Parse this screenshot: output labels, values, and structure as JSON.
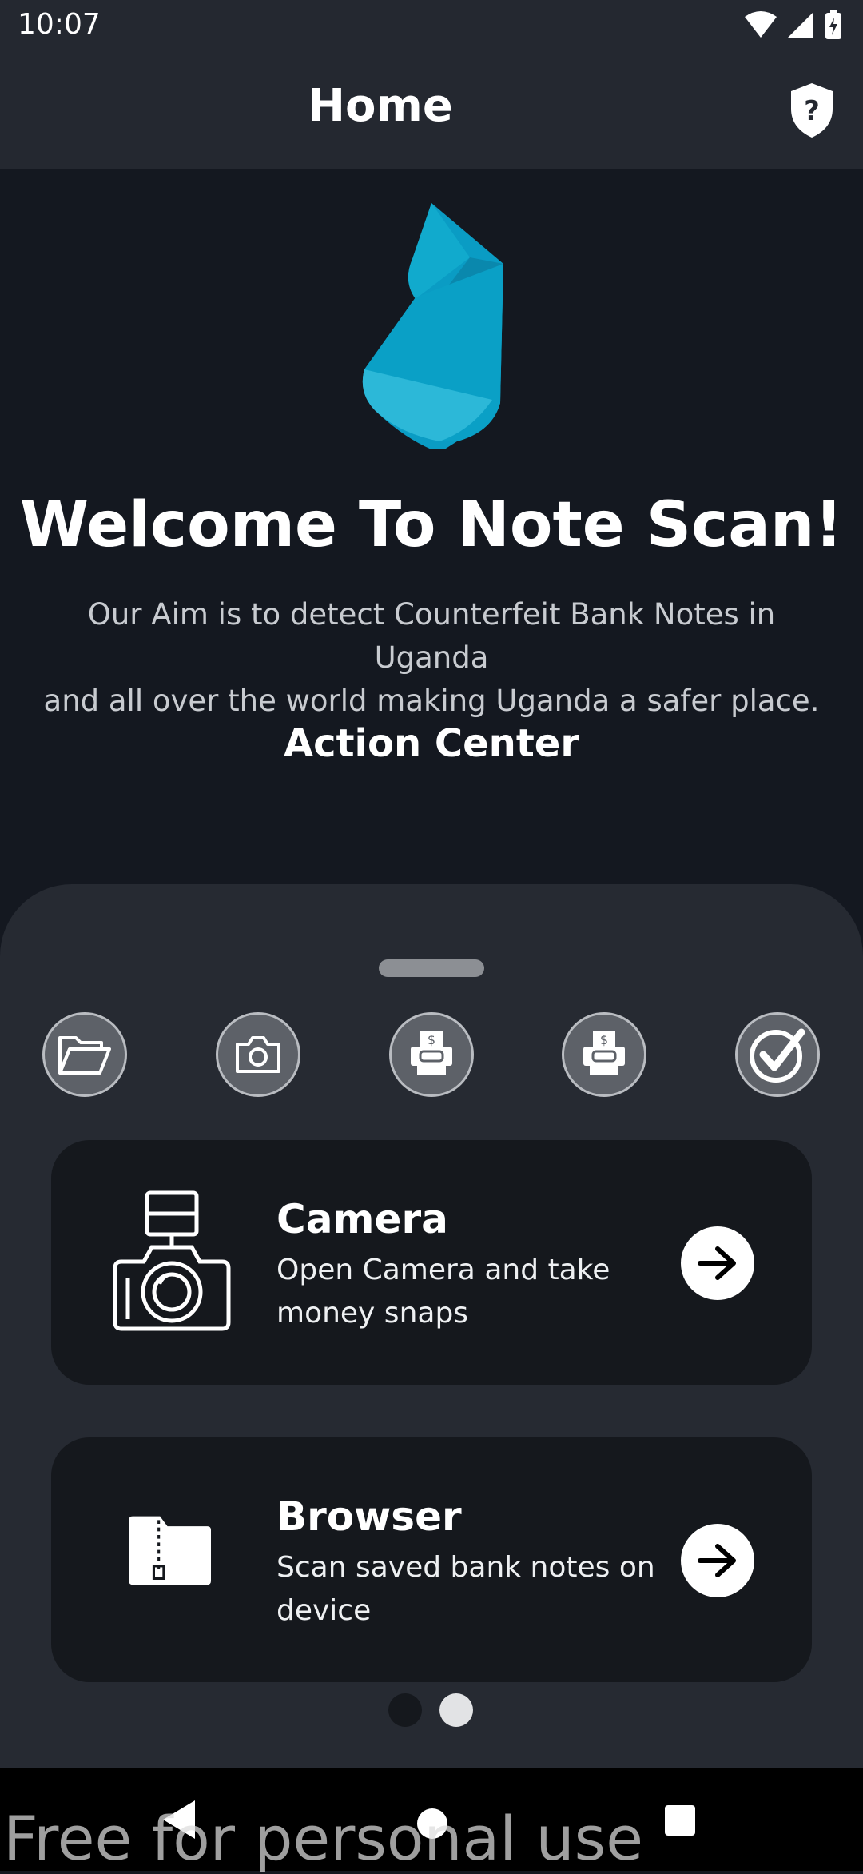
{
  "status_bar": {
    "time": "10:07",
    "icons": [
      "wifi-icon",
      "signal-icon",
      "battery-charging-icon"
    ]
  },
  "app_bar": {
    "title": "Home",
    "help_icon": "shield-question-icon"
  },
  "hero": {
    "welcome": "Welcome To Note Scan!",
    "aim_line1": "Our Aim is to detect Counterfeit Bank Notes in Uganda",
    "aim_line2": "and all over the world making Uganda a safer place.",
    "section_title": "Action Center"
  },
  "quick_actions": [
    {
      "icon": "folder-open-icon"
    },
    {
      "icon": "camera-icon"
    },
    {
      "icon": "money-scan-icon"
    },
    {
      "icon": "money-scan-icon"
    },
    {
      "icon": "check-circle-icon"
    }
  ],
  "cards": [
    {
      "title": "Camera",
      "desc_line1": "Open Camera and take",
      "desc_line2": "money snaps",
      "icon": "camera-flash-icon"
    },
    {
      "title": "Browser",
      "desc_line1": "Scan saved bank notes on",
      "desc_line2": "device",
      "icon": "zip-file-icon"
    }
  ],
  "pager": {
    "pages": 2,
    "active": 2
  },
  "watermark": "Free for personal use",
  "colors": {
    "background": "#141820",
    "sheet": "#262a32",
    "card": "#15181d",
    "logo": "#0a9cc4"
  }
}
